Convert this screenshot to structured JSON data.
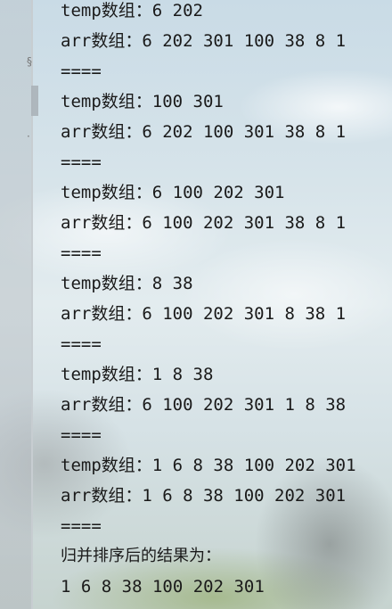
{
  "console": {
    "lines": [
      "temp数组：6 202",
      "arr数组：6 202 301 100 38 8 1",
      "====",
      "temp数组：100 301",
      "arr数组：6 202 100 301 38 8 1",
      "====",
      "temp数组：6 100 202 301",
      "arr数组：6 100 202 301 38 8 1",
      "====",
      "temp数组：8 38",
      "arr数组：6 100 202 301 8 38 1",
      "====",
      "temp数组：1 8 38",
      "arr数组：6 100 202 301 1 8 38",
      "====",
      "temp数组：1 6 8 38 100 202 301",
      "arr数组：1 6 8 38 100 202 301",
      "====",
      "归并排序后的结果为：",
      "1 6 8 38 100 202 301"
    ]
  }
}
